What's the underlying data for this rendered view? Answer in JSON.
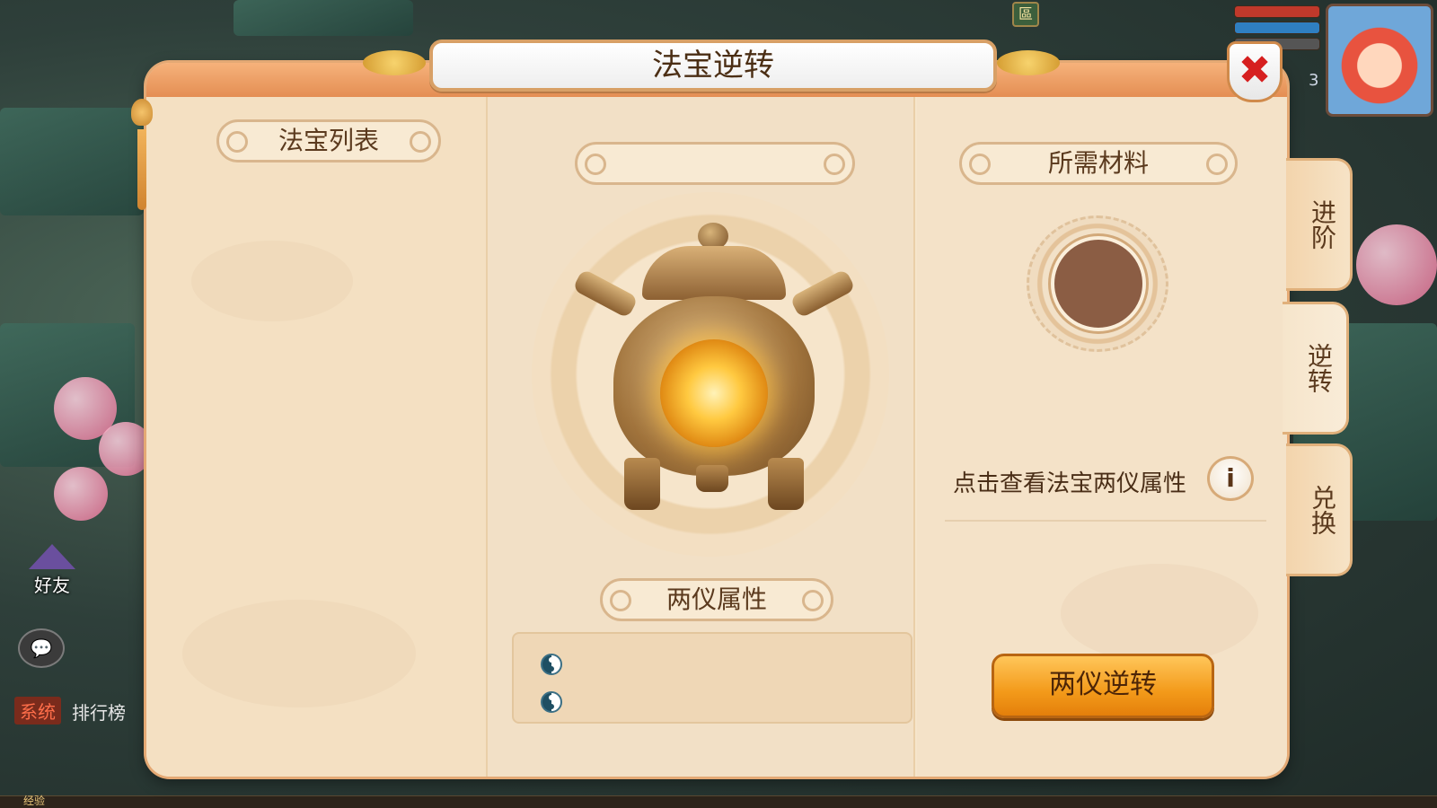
{
  "window": {
    "title": "法宝逆转",
    "close_icon": "close-icon",
    "close_glyph": "✖"
  },
  "left_panel": {
    "header": "法宝列表"
  },
  "center_panel": {
    "selected_name": "",
    "treasure_icon": "treasure-pot-icon",
    "attr_header": "两仪属性",
    "attributes": [
      {
        "icon": "yinyang-icon",
        "value": ""
      },
      {
        "icon": "yinyang-icon",
        "value": ""
      }
    ]
  },
  "right_panel": {
    "header": "所需材料",
    "material_slot_icon": "empty-slot-icon",
    "info_text": "点击查看法宝两仪属性",
    "info_icon": "info-icon",
    "info_glyph": "i",
    "action_button": "两仪逆转"
  },
  "side_tabs": [
    {
      "label": "进阶",
      "active": false
    },
    {
      "label": "逆转",
      "active": true
    },
    {
      "label": "兑换",
      "active": false
    }
  ],
  "hud": {
    "friend_label": "好友",
    "chat_icon": "chat-icon",
    "chat_glyph": "💬",
    "system_tag": "系统",
    "rank_text": "排行榜",
    "exp_label": "经验",
    "map_icon": "map-icon",
    "map_glyph": "區",
    "avatar_icon": "avatar-icon",
    "level_number": "3"
  },
  "colors": {
    "panel_bg": "#f6e5cb",
    "accent_orange": "#e48e53",
    "button_orange": "#f39a1a",
    "close_red": "#d61f1f",
    "text_brown": "#5b3a1e"
  }
}
